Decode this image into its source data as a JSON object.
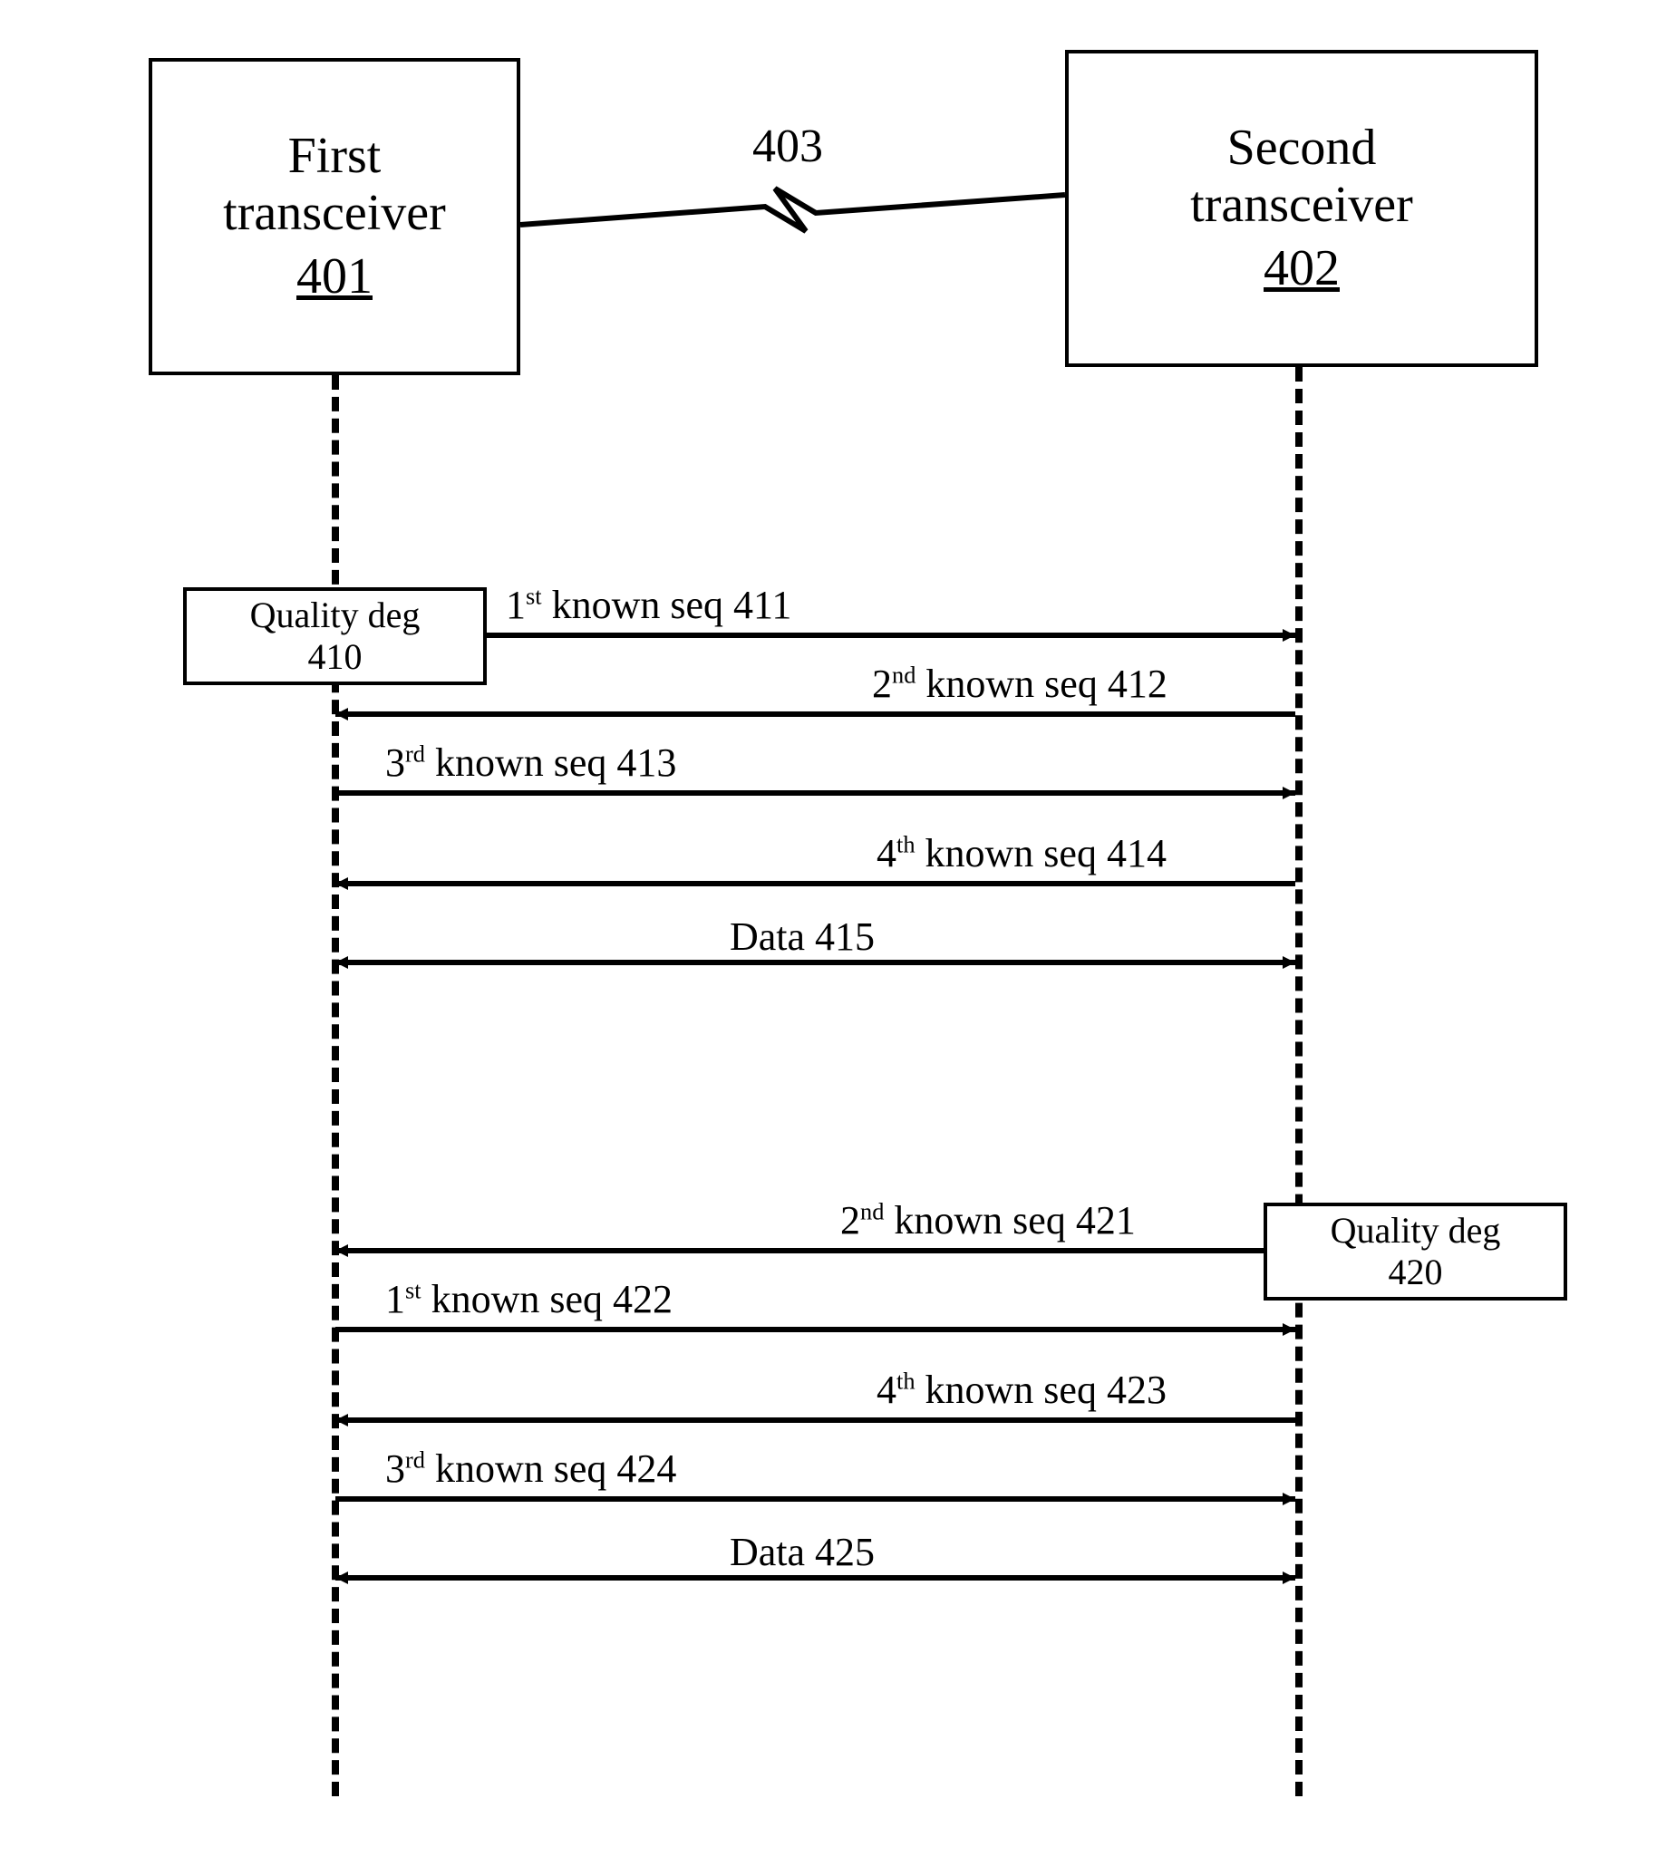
{
  "transceivers": {
    "first": {
      "title": "First\ntransceiver",
      "ref": "401"
    },
    "second": {
      "title": "Second\ntransceiver",
      "ref": "402"
    }
  },
  "link": {
    "ref": "403"
  },
  "events": {
    "qd_left": {
      "name": "Quality deg",
      "ref": "410"
    },
    "qd_right": {
      "name": "Quality deg",
      "ref": "420"
    }
  },
  "messages": {
    "m411": {
      "ord": "1",
      "sup": "st",
      "tail": " known seq 411"
    },
    "m412": {
      "ord": "2",
      "sup": "nd",
      "tail": " known seq 412"
    },
    "m413": {
      "ord": "3",
      "sup": "rd",
      "tail": " known seq 413"
    },
    "m414": {
      "ord": "4",
      "sup": "th",
      "tail": " known seq 414"
    },
    "m415": {
      "text": "Data 415"
    },
    "m421": {
      "ord": "2",
      "sup": "nd",
      "tail": " known seq 421"
    },
    "m422": {
      "ord": "1",
      "sup": "st",
      "tail": " known seq 422"
    },
    "m423": {
      "ord": "4",
      "sup": "th",
      "tail": " known seq 423"
    },
    "m424": {
      "ord": "3",
      "sup": "rd",
      "tail": " known seq 424"
    },
    "m425": {
      "text": "Data 425"
    }
  }
}
